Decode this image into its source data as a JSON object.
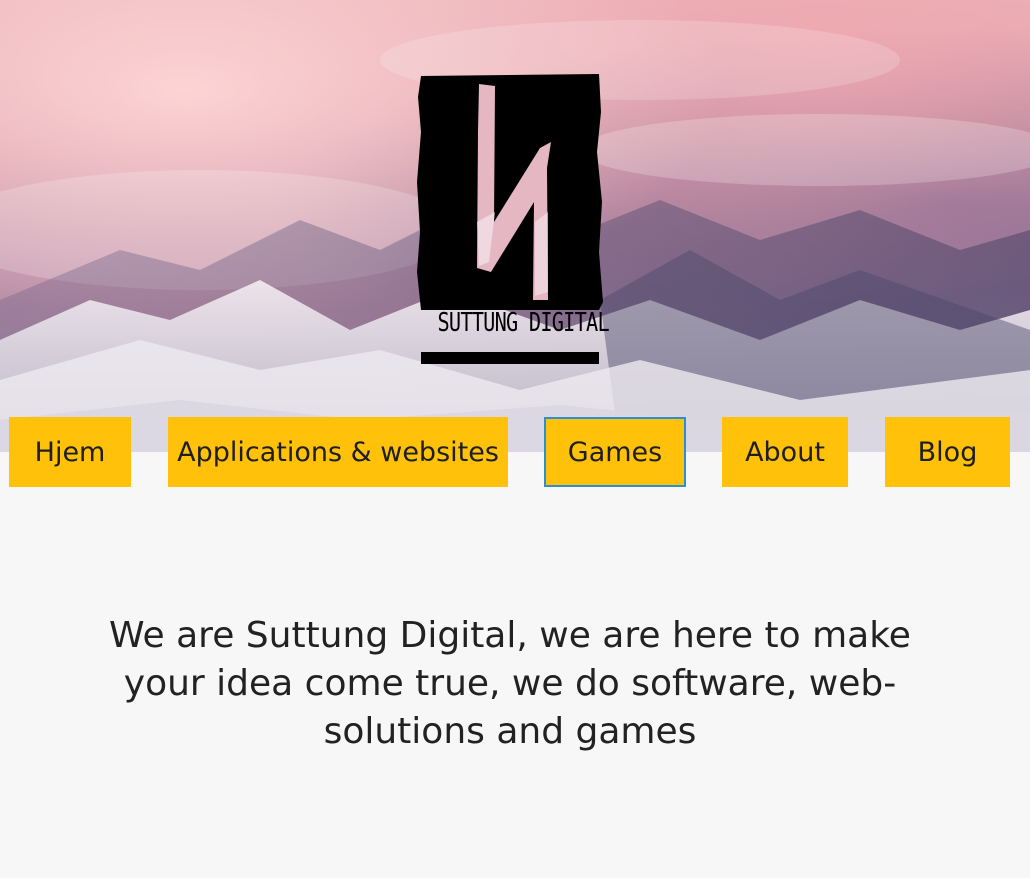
{
  "header": {
    "brand_name": "SUTTUNG DIGITAL"
  },
  "nav": {
    "items": [
      {
        "label": "Hjem",
        "active": false
      },
      {
        "label": "Applications & websites",
        "active": false
      },
      {
        "label": "Games",
        "active": true
      },
      {
        "label": "About",
        "active": false
      },
      {
        "label": "Blog",
        "active": false
      }
    ]
  },
  "main": {
    "tagline": "We are Suttung Digital, we are here to make your idea come true, we do software, web-solutions and games"
  },
  "colors": {
    "nav_background": "#ffc10a",
    "active_border": "#2b8fd6",
    "page_background": "#f7f7f7"
  }
}
